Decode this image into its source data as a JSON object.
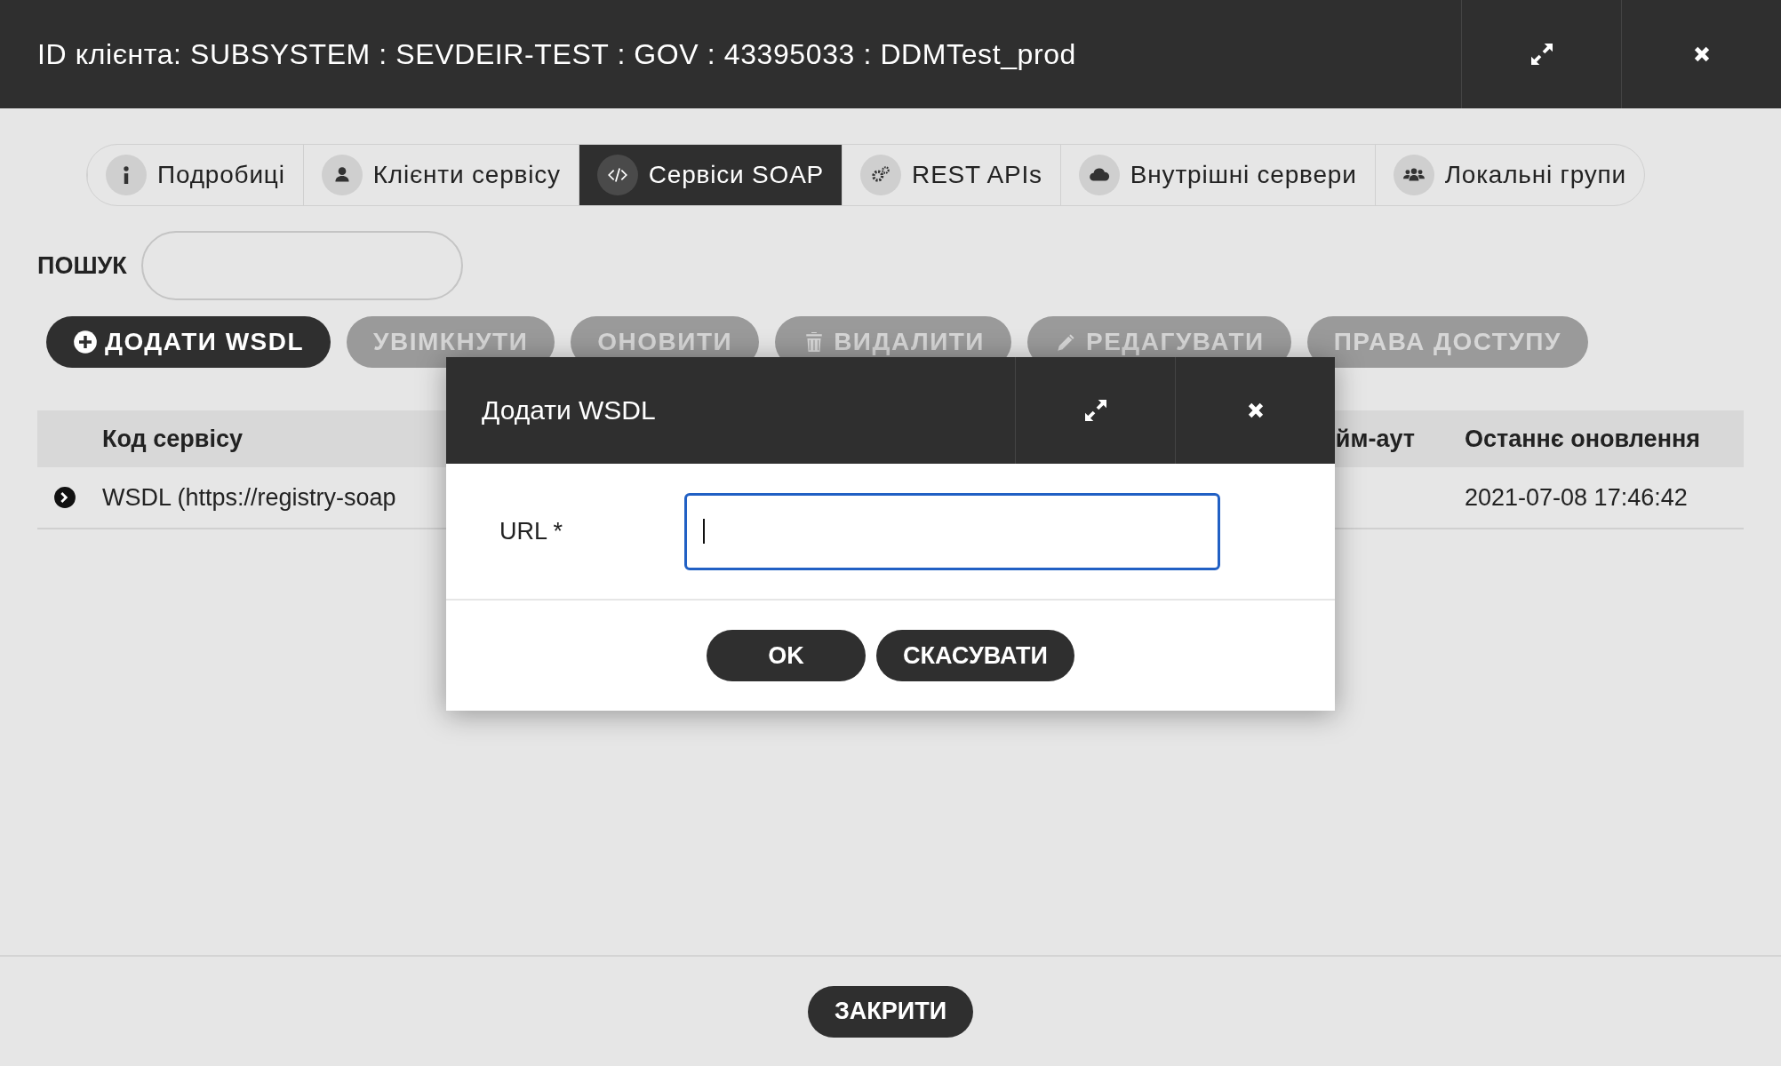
{
  "window": {
    "title": "ID клієнта: SUBSYSTEM : SEVDEIR-TEST : GOV : 43395033 : DDMTest_prod"
  },
  "tabs": [
    {
      "label": "Подробиці",
      "selected": false
    },
    {
      "label": "Клієнти сервісу",
      "selected": false
    },
    {
      "label": "Сервіси SOAP",
      "selected": true
    },
    {
      "label": "REST APIs",
      "selected": false
    },
    {
      "label": "Внутрішні сервери",
      "selected": false
    },
    {
      "label": "Локальні групи",
      "selected": false
    }
  ],
  "search": {
    "label": "ПОШУК"
  },
  "toolbar": [
    {
      "label": "ДОДАТИ WSDL",
      "kind": "add",
      "disabled": false
    },
    {
      "label": "УВІМКНУТИ",
      "kind": "plain",
      "disabled": true
    },
    {
      "label": "ОНОВИТИ",
      "kind": "plain",
      "disabled": true
    },
    {
      "label": "ВИДАЛИТИ",
      "kind": "delete",
      "disabled": true
    },
    {
      "label": "РЕДАГУВАТИ",
      "kind": "edit",
      "disabled": true
    },
    {
      "label": "ПРАВА ДОСТУПУ",
      "kind": "plain",
      "disabled": true
    }
  ],
  "table": {
    "columns": [
      "Код сервісу",
      "йм-аут",
      "Останнє оновлення"
    ],
    "rows": [
      {
        "service_code": "WSDL (https://registry-soap",
        "last_updated": "2021-07-08 17:46:42"
      }
    ]
  },
  "dialog": {
    "title": "Додати WSDL",
    "field": {
      "label": "URL *",
      "focused": true
    },
    "buttons": [
      "OK",
      "СКАСУВАТИ"
    ]
  },
  "footer": {
    "button": "ЗАКРИТИ"
  }
}
